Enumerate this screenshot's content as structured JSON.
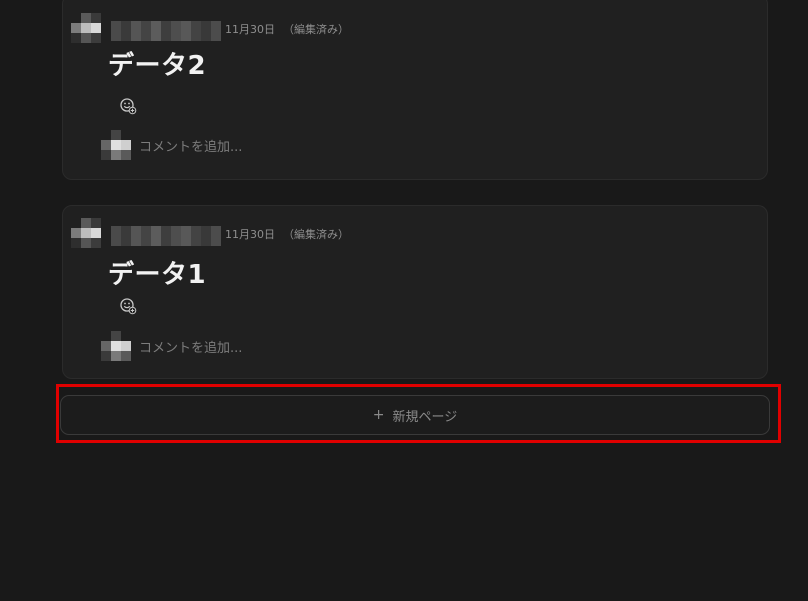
{
  "posts": [
    {
      "timestamp": "11月30日",
      "edited_label": "（編集済み）",
      "title": "データ2",
      "comment_placeholder": "コメントを追加..."
    },
    {
      "timestamp": "11月30日",
      "edited_label": "（編集済み）",
      "title": "データ1",
      "comment_placeholder": "コメントを追加..."
    }
  ],
  "new_page": {
    "icon": "plus-icon",
    "label": "新規ページ"
  },
  "colors": {
    "background": "#191919",
    "card": "#202020",
    "highlight": "#e00000"
  }
}
